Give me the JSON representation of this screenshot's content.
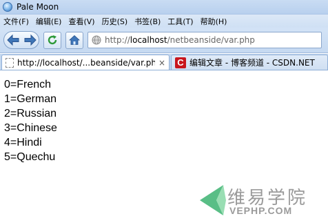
{
  "window": {
    "title": "Pale Moon"
  },
  "menu": [
    "文件(F)",
    "编辑(E)",
    "查看(V)",
    "历史(S)",
    "书签(B)",
    "工具(T)",
    "帮助(H)"
  ],
  "navbar": {
    "url_prefix": "http://",
    "url_host": "localhost",
    "url_path": "/netbeanside/var.php"
  },
  "tabs": [
    {
      "label": "http://localhost/...beanside/var.php",
      "close": "×",
      "icon": "blank-page-icon"
    },
    {
      "label": "编辑文章 - 博客频道 - CSDN.NET",
      "icon": "csdn-icon",
      "icon_text": "C"
    }
  ],
  "content": {
    "lines": [
      "0=French",
      "1=German",
      "2=Russian",
      "3=Chinese",
      "4=Hindi",
      "5=Quechu"
    ]
  },
  "watermark": {
    "cn": "维易学院",
    "en": "VEPHP.COM"
  },
  "colors": {
    "accent": "#2a6fbd",
    "csdn_red": "#c8161d",
    "watermark_green": "#3cb371",
    "refresh_green": "#2e9a3a"
  }
}
